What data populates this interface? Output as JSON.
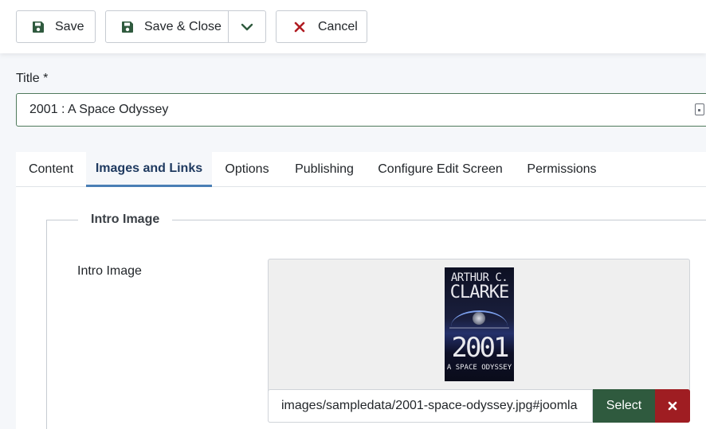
{
  "toolbar": {
    "save_label": "Save",
    "save_close_label": "Save & Close",
    "cancel_label": "Cancel"
  },
  "title_field": {
    "label": "Title *",
    "value": "2001 : A Space Odyssey"
  },
  "tabs": [
    {
      "label": "Content",
      "active": false
    },
    {
      "label": "Images and Links",
      "active": true
    },
    {
      "label": "Options",
      "active": false
    },
    {
      "label": "Publishing",
      "active": false
    },
    {
      "label": "Configure Edit Screen",
      "active": false
    },
    {
      "label": "Permissions",
      "active": false
    }
  ],
  "intro_image": {
    "legend": "Intro Image",
    "field_label": "Intro Image",
    "path_value": "images/sampledata/2001-space-odyssey.jpg#joomla",
    "select_label": "Select",
    "cover": {
      "author_line1": "ARTHUR C.",
      "author_line2": "CLARKE",
      "title_year": "2001",
      "subtitle": "A SPACE ODYSSEY"
    }
  },
  "colors": {
    "save_icon": "#2f5a3e",
    "cancel_icon": "#b01c22",
    "active_tab_text": "#1f3a60",
    "active_tab_border": "#4a7fb5",
    "select_button": "#2f5a3e",
    "clear_button": "#9f1d22"
  },
  "icons": {
    "save": "floppy-disk-icon",
    "dropdown": "chevron-down-icon",
    "cancel": "close-icon",
    "clear": "close-icon"
  }
}
